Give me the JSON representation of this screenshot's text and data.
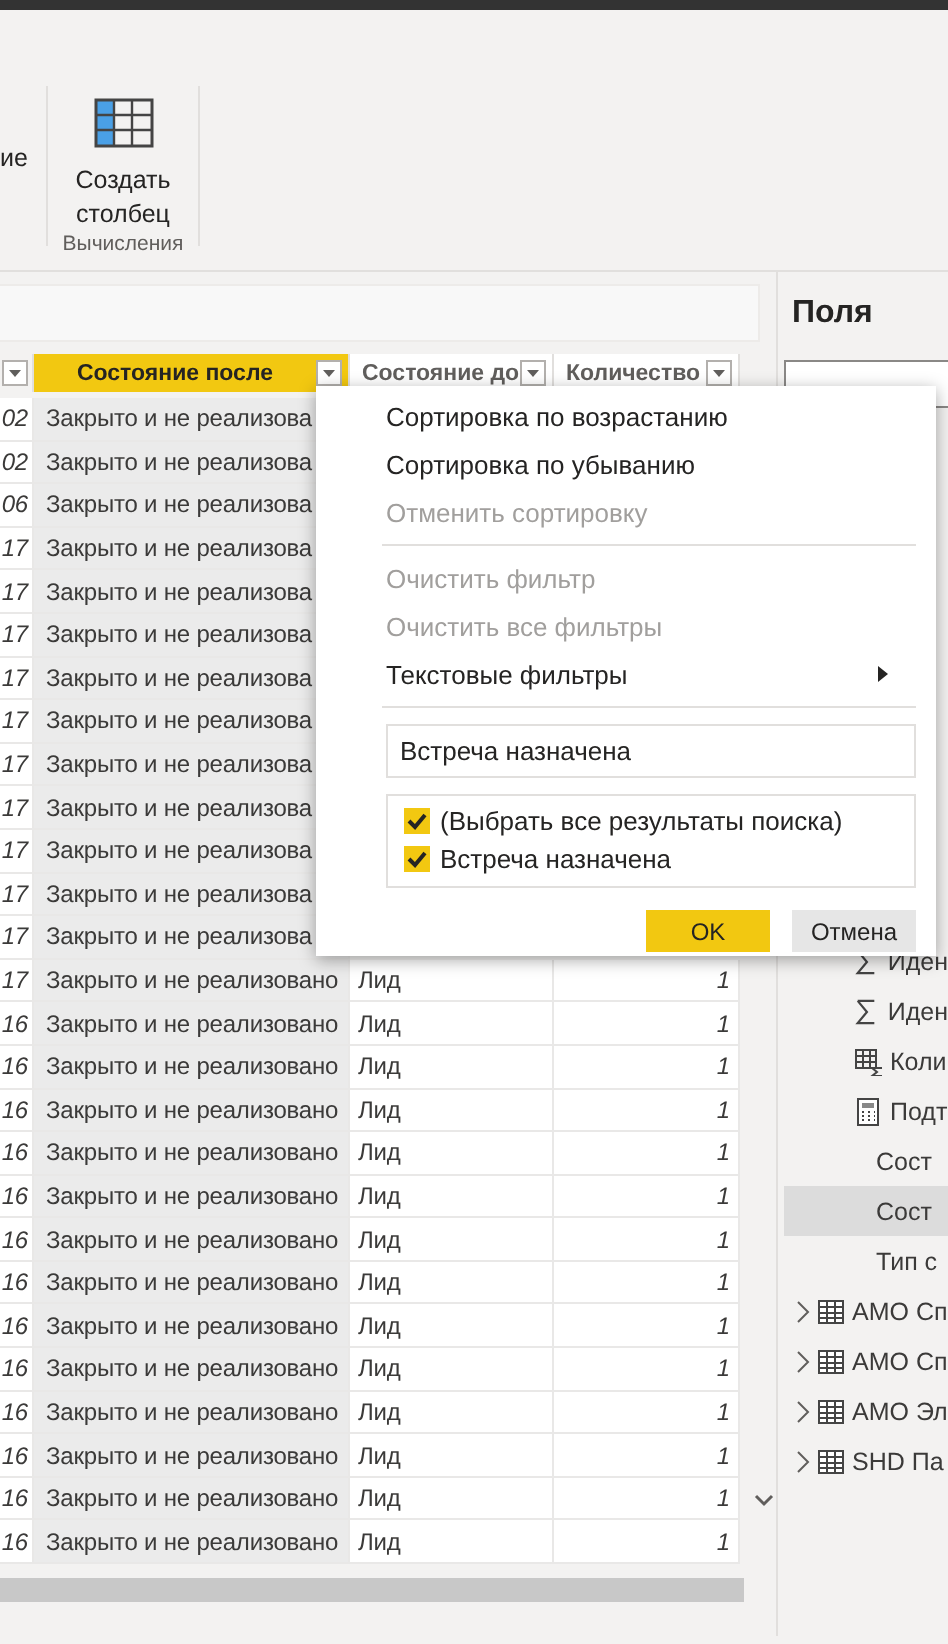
{
  "ribbon": {
    "cut_label": "ие",
    "button": {
      "label": "Создать столбец"
    },
    "group_label": "Вычисления"
  },
  "table": {
    "columns": [
      {
        "kind": "cut",
        "selected": false
      },
      {
        "kind": "named",
        "label": "Состояние после",
        "selected": true
      },
      {
        "kind": "named",
        "label": "Состояние до",
        "selected": false
      },
      {
        "kind": "named",
        "label": "Количество",
        "selected": false
      }
    ],
    "rows": [
      {
        "cells": [
          "02",
          "Закрыто и не реализова"
        ]
      },
      {
        "cells": [
          "02",
          "Закрыто и не реализова"
        ]
      },
      {
        "cells": [
          "06",
          "Закрыто и не реализова"
        ]
      },
      {
        "cells": [
          "17",
          "Закрыто и не реализова"
        ]
      },
      {
        "cells": [
          "17",
          "Закрыто и не реализова"
        ]
      },
      {
        "cells": [
          "17",
          "Закрыто и не реализова"
        ]
      },
      {
        "cells": [
          "17",
          "Закрыто и не реализова"
        ]
      },
      {
        "cells": [
          "17",
          "Закрыто и не реализова"
        ]
      },
      {
        "cells": [
          "17",
          "Закрыто и не реализова"
        ]
      },
      {
        "cells": [
          "17",
          "Закрыто и не реализова"
        ]
      },
      {
        "cells": [
          "17",
          "Закрыто и не реализова"
        ]
      },
      {
        "cells": [
          "17",
          "Закрыто и не реализова"
        ]
      },
      {
        "cells": [
          "17",
          "Закрыто и не реализова"
        ]
      },
      {
        "cells": [
          "17",
          "Закрыто и не реализовано",
          "Лид",
          "1"
        ]
      },
      {
        "cells": [
          "16",
          "Закрыто и не реализовано",
          "Лид",
          "1"
        ]
      },
      {
        "cells": [
          "16",
          "Закрыто и не реализовано",
          "Лид",
          "1"
        ]
      },
      {
        "cells": [
          "16",
          "Закрыто и не реализовано",
          "Лид",
          "1"
        ]
      },
      {
        "cells": [
          "16",
          "Закрыто и не реализовано",
          "Лид",
          "1"
        ]
      },
      {
        "cells": [
          "16",
          "Закрыто и не реализовано",
          "Лид",
          "1"
        ]
      },
      {
        "cells": [
          "16",
          "Закрыто и не реализовано",
          "Лид",
          "1"
        ]
      },
      {
        "cells": [
          "16",
          "Закрыто и не реализовано",
          "Лид",
          "1"
        ]
      },
      {
        "cells": [
          "16",
          "Закрыто и не реализовано",
          "Лид",
          "1"
        ]
      },
      {
        "cells": [
          "16",
          "Закрыто и не реализовано",
          "Лид",
          "1"
        ]
      },
      {
        "cells": [
          "16",
          "Закрыто и не реализовано",
          "Лид",
          "1"
        ]
      },
      {
        "cells": [
          "16",
          "Закрыто и не реализовано",
          "Лид",
          "1"
        ]
      },
      {
        "cells": [
          "16",
          "Закрыто и не реализовано",
          "Лид",
          "1"
        ]
      },
      {
        "cells": [
          "16",
          "Закрыто и не реализовано",
          "Лид",
          "1"
        ]
      }
    ]
  },
  "filter_menu": {
    "groups": [
      [
        {
          "label": "Сортировка по возрастанию",
          "disabled": false,
          "kind": "item"
        },
        {
          "label": "Сортировка по убыванию",
          "disabled": false,
          "kind": "item"
        },
        {
          "label": "Отменить сортировку",
          "disabled": true,
          "kind": "item"
        }
      ],
      [
        {
          "label": "Очистить фильтр",
          "disabled": true,
          "kind": "item"
        },
        {
          "label": "Очистить все фильтры",
          "disabled": true,
          "kind": "item"
        },
        {
          "label": "Текстовые фильтры",
          "disabled": false,
          "kind": "submenu"
        }
      ]
    ],
    "search": {
      "value": "Встреча назначена"
    },
    "options": [
      {
        "label": "(Выбрать все результаты поиска)",
        "checked": true
      },
      {
        "label": "Встреча назначена",
        "checked": true
      }
    ],
    "buttons": [
      {
        "label": "OK",
        "kind": "primary"
      },
      {
        "label": "Отмена",
        "kind": "secondary"
      }
    ]
  },
  "fields_pane": {
    "title": "Поля",
    "fields": [
      {
        "label": "Иден",
        "kind": "sigma",
        "selected": false
      },
      {
        "label": "Иден",
        "kind": "sigma",
        "selected": false
      },
      {
        "label": "Коли",
        "kind": "measure",
        "selected": false
      },
      {
        "label": "Подт",
        "kind": "calculator",
        "selected": false
      },
      {
        "label": "Сост",
        "kind": "plain",
        "selected": false
      },
      {
        "label": "Сост",
        "kind": "plain",
        "selected": true
      },
      {
        "label": "Тип с",
        "kind": "plain",
        "selected": false
      }
    ],
    "tables": [
      {
        "label": "АМО Сп",
        "expanded": false
      },
      {
        "label": "АМО Сп",
        "expanded": false
      },
      {
        "label": "АМО Эл",
        "expanded": false
      },
      {
        "label": "SHD Па",
        "expanded": false
      }
    ]
  }
}
